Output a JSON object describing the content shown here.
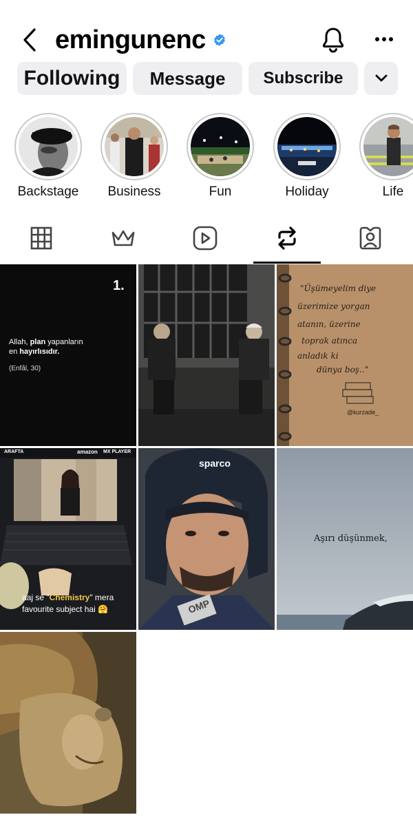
{
  "header": {
    "username": "emingunenc",
    "back_icon": "chevron-left-icon",
    "verified_icon": "verified-badge-icon",
    "verified_color": "#3797f0",
    "bell_icon": "bell-icon",
    "more_icon": "more-horizontal-icon"
  },
  "actions": {
    "following_label": "Following",
    "message_label": "Message",
    "subscribe_label": "Subscribe",
    "dropdown_icon": "chevron-down-icon"
  },
  "highlights": [
    {
      "label": "Backstage"
    },
    {
      "label": "Business"
    },
    {
      "label": "Fun"
    },
    {
      "label": "Holiday"
    },
    {
      "label": "Life"
    }
  ],
  "tabs": [
    {
      "icon": "grid-icon",
      "active": false
    },
    {
      "icon": "crown-icon",
      "active": false
    },
    {
      "icon": "reels-icon",
      "active": false
    },
    {
      "icon": "repost-icon",
      "active": true
    },
    {
      "icon": "tagged-icon",
      "active": false
    }
  ],
  "posts": {
    "post1": {
      "number": "1.",
      "line1_a": "Allah, ",
      "line1_b": "plan",
      "line1_c": " yapanların",
      "line2_a": "en ",
      "line2_b": "hayırlısıdır.",
      "reference": "(Enfâl, 30)"
    },
    "post3": {
      "handwriting": [
        "\"Üşümeyelim diye",
        "üzerimize yorgan",
        "atanın, üzerine",
        "toprak atınca",
        "anladık ki",
        "dünya boş..\""
      ],
      "signature": "@kurzade_"
    },
    "post4": {
      "brand_left": "ARAFTA",
      "brand_amazon": "amazon",
      "brand_mx": "MX PLAYER",
      "caption_a": "aaj se \"",
      "caption_b": "Chemistry",
      "caption_c": "\" mera",
      "caption_line2": "favourite subject hai 🤗"
    },
    "post5": {
      "helmet_brand": "sparco",
      "badge": "OMP"
    },
    "post6": {
      "text": "Aşırı düşünmek,"
    }
  }
}
